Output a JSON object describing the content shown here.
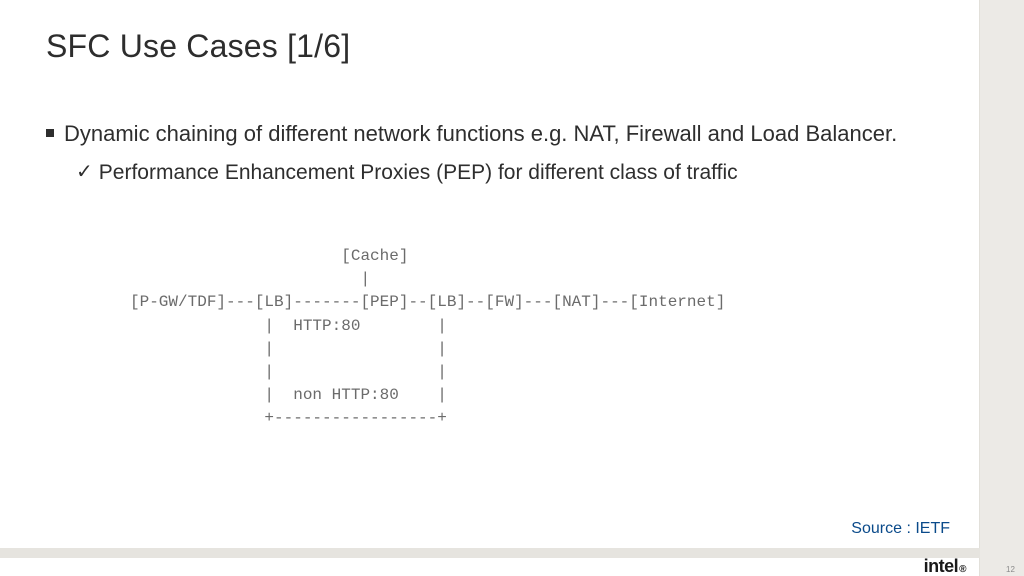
{
  "title": "SFC Use Cases [1/6]",
  "bullet1": "Dynamic chaining of different network functions e.g. NAT, Firewall and Load Balancer.",
  "sub1": "Performance Enhancement Proxies (PEP) for different class of traffic",
  "diagram": "                      [Cache]\n                        |\n[P-GW/TDF]---[LB]-------[PEP]--[LB]--[FW]---[NAT]---[Internet]\n              |  HTTP:80        |\n              |                 |\n              |                 |\n              |  non HTTP:80    |\n              +-----------------+",
  "source": "Source : IETF",
  "logo": "intel",
  "page": "12"
}
